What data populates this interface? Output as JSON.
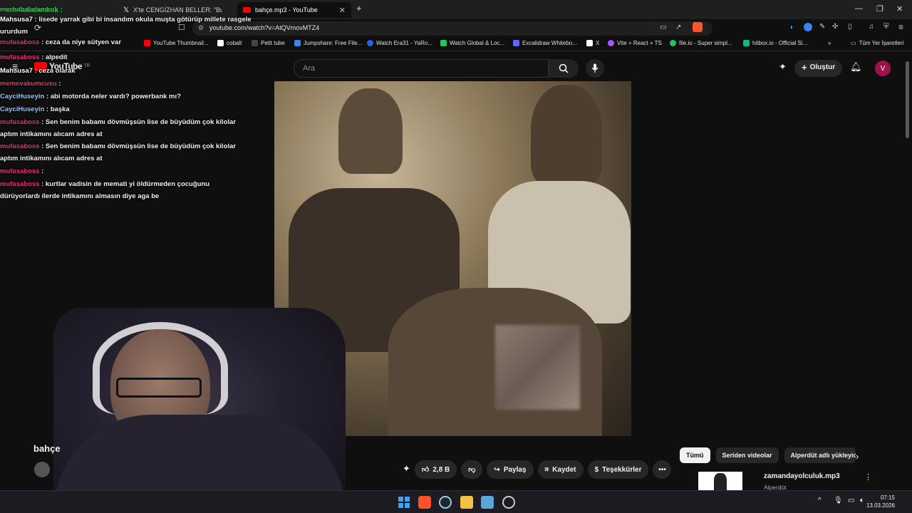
{
  "browser": {
    "tabs": [
      {
        "label": "merhabalaramk :"
      },
      {
        "label": "X'te CENGİZHAN BELLER: \"Bu videoy"
      },
      {
        "label": "bahçe.mp3 - YouTube"
      }
    ],
    "url": "youtube.com/watch?v=AtQVmovMTZ4",
    "bookmarks": [
      {
        "label": "YouTube Thumbnail...",
        "color": "#ff0000"
      },
      {
        "label": "cobalt",
        "color": "#ffffff"
      },
      {
        "label": "Petit tube",
        "color": "#444444"
      },
      {
        "label": "Jumpshare: Free File...",
        "color": "#3b82f6"
      },
      {
        "label": "Watch Era31 - YaRo...",
        "color": "#2563eb"
      },
      {
        "label": "Watch Global & Loc...",
        "color": "#22c55e"
      },
      {
        "label": "Excalidraw Whitebo...",
        "color": "#6366f1"
      },
      {
        "label": "X",
        "color": "#ffffff"
      },
      {
        "label": "Vite + React + TS",
        "color": "#a855f7"
      },
      {
        "label": "file.io - Super simpl...",
        "color": "#22c55e"
      },
      {
        "label": "hitbox.io - Official Si...",
        "color": "#10b981"
      }
    ],
    "all_bookmarks": "Tüm Yer İşaretleri"
  },
  "youtube": {
    "logo": "YouTube",
    "logo_suffix": "TR",
    "search_placeholder": "Ara",
    "create_label": "Oluştur",
    "avatar_letter": "V"
  },
  "chat": {
    "messages": [
      {
        "user": "Mahsusa7",
        "user_color": "#ffffff",
        "text": ": lisede yarrak gibi bi insandım okula muşta götürüp millete rasgele"
      },
      {
        "user": "",
        "user_color": "#ffffff",
        "text": "ururdum"
      },
      {
        "user": "mufasaboss",
        "user_color": "#e0366f",
        "text": ": ceza da niye sütyen var"
      },
      {
        "user": "mufasaboss",
        "user_color": "#e0366f",
        "text": ": alpedit"
      },
      {
        "user": "Mahsusa7",
        "user_color": "#ffffff",
        "text": ": ceza olarak"
      },
      {
        "user": "memevakumcusu",
        "user_color": "#e0366f",
        "text": ":"
      },
      {
        "user": "CayciHuseyin",
        "user_color": "#8ec8ff",
        "text": ": abi motorda neler vardı? powerbank mı?"
      },
      {
        "user": "CayciHuseyin",
        "user_color": "#8ec8ff",
        "text": ": başka"
      },
      {
        "user": "mufasaboss",
        "user_color": "#e0366f",
        "text": ": Sen benim babamı dövmüşsün lise de büyüdüm çok kilolar"
      },
      {
        "user": "",
        "user_color": "#ffffff",
        "text": "aptım intikamını alıcam adres at"
      },
      {
        "user": "mufasaboss",
        "user_color": "#e0366f",
        "text": ": Sen benim babamı dövmüşsün lise de büyüdüm çok kilolar"
      },
      {
        "user": "",
        "user_color": "#ffffff",
        "text": "aptım intikamını alıcam adres at"
      },
      {
        "user": "mufasaboss",
        "user_color": "#e0366f",
        "text": ":"
      },
      {
        "user": "mufasaboss",
        "user_color": "#e0366f",
        "text": ": kurtlar vadisin de memati yi öldürmeden çocuğunu"
      },
      {
        "user": "",
        "user_color": "#ffffff",
        "text": "dürüyorlardı ilerde intikamını almasın diye aga be"
      }
    ]
  },
  "video": {
    "title": "bahçe",
    "like_count": "2,8 B",
    "share_label": "Paylaş",
    "save_label": "Kaydet",
    "thanks_label": "Teşekkürler",
    "more_label": "•••"
  },
  "sidebar": {
    "chips": [
      {
        "label": "Tümü"
      },
      {
        "label": "Seriden videolar"
      },
      {
        "label": "Alperdüt adlı yükleyic"
      }
    ],
    "recommendation": {
      "title": "zamandayolculuk.mp3",
      "channel": "Alperdüt"
    }
  },
  "taskbar": {
    "time": "07:15",
    "date": "13.03.2026"
  }
}
